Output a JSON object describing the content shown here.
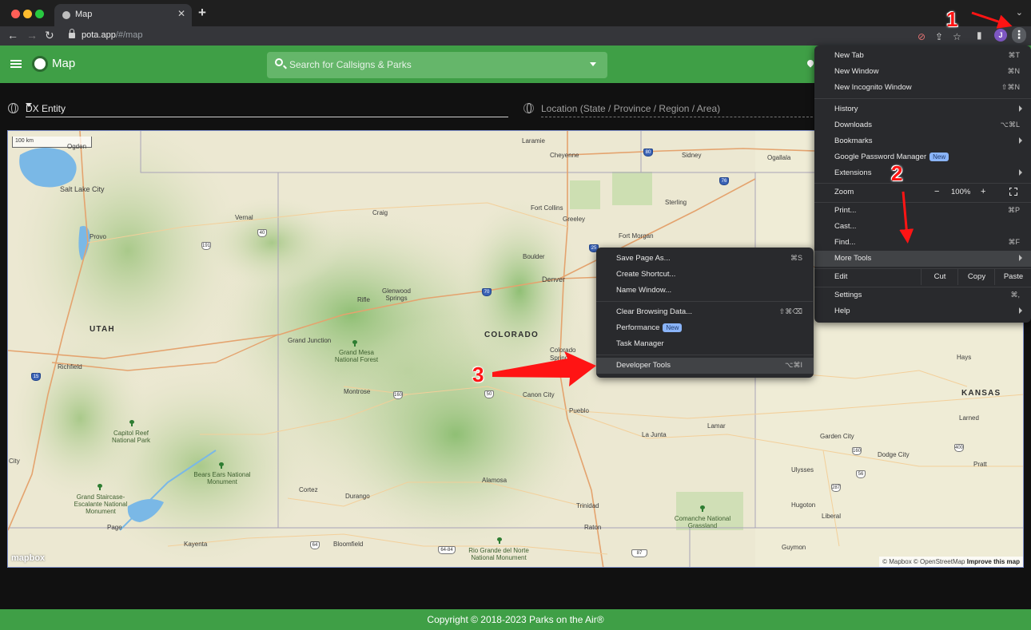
{
  "browser": {
    "tab_title": "Map",
    "tab_close": "✕",
    "new_tab": "+",
    "tab_search": "⌄",
    "url_host": "pota.app",
    "url_path": "/#/map",
    "avatar_initial": "J",
    "menu_kebab": "⋮"
  },
  "app": {
    "title": "Map",
    "search_placeholder": "Search for Callsigns & Parks",
    "dx_entity": "DX Entity",
    "location_placeholder": "Location (State / Province / Region / Area)",
    "footer": "Copyright © 2018-2023 Parks on the Air®"
  },
  "map": {
    "scale": "100 km",
    "mapbox": "mapbox",
    "attribution": "© Mapbox © OpenStreetMap",
    "improve": "Improve this map",
    "states": [
      "UTAH",
      "COLORADO",
      "KANSAS"
    ],
    "cities": [
      "Ogden",
      "Salt Lake City",
      "Provo",
      "Vernal",
      "Craig",
      "Laramie",
      "Cheyenne",
      "Sidney",
      "Ogallala",
      "Fort Collins",
      "Greeley",
      "Sterling",
      "Fort Morgan",
      "Boulder",
      "Denver",
      "Glenwood Springs",
      "Rifle",
      "Grand Junction",
      "Colorado Springs",
      "Canon City",
      "Pueblo",
      "Montrose",
      "Richfield",
      "La Junta",
      "Lamar",
      "Garden City",
      "Dodge City",
      "Hays",
      "Larned",
      "Pratt",
      "Ulysses",
      "Hugoton",
      "Liberal",
      "Guymon",
      "Trinidad",
      "Raton",
      "Alamosa",
      "Durango",
      "Cortez",
      "Bloomfield",
      "Kayenta",
      "Page",
      "City"
    ],
    "parks": [
      "Grand Mesa National Forest",
      "Capitol Reef National Park",
      "Bears Ears National Monument",
      "Grand Staircase-Escalante National Monument",
      "Rio Grande del Norte National Monument",
      "Comanche National Grassland"
    ],
    "highway_shields": [
      "80",
      "76",
      "25",
      "70",
      "40",
      "191",
      "15",
      "50",
      "160",
      "64",
      "64-84",
      "56",
      "87",
      "287",
      "400",
      "160"
    ]
  },
  "chrome_menu": {
    "items": [
      {
        "label": "New Tab",
        "shortcut": "⌘T"
      },
      {
        "label": "New Window",
        "shortcut": "⌘N"
      },
      {
        "label": "New Incognito Window",
        "shortcut": "⇧⌘N"
      },
      {
        "label": "History"
      },
      {
        "label": "Downloads",
        "shortcut": "⌥⌘L"
      },
      {
        "label": "Bookmarks"
      },
      {
        "label": "Google Password Manager",
        "badge": "New"
      },
      {
        "label": "Extensions"
      },
      {
        "label": "Zoom",
        "minus": "−",
        "value": "100%",
        "plus": "+"
      },
      {
        "label": "Print...",
        "shortcut": "⌘P"
      },
      {
        "label": "Cast..."
      },
      {
        "label": "Find...",
        "shortcut": "⌘F"
      },
      {
        "label": "More Tools"
      },
      {
        "label": "Edit",
        "cut": "Cut",
        "copy": "Copy",
        "paste": "Paste"
      },
      {
        "label": "Settings",
        "shortcut": "⌘,"
      },
      {
        "label": "Help"
      }
    ]
  },
  "more_tools_menu": {
    "items": [
      {
        "label": "Save Page As...",
        "shortcut": "⌘S"
      },
      {
        "label": "Create Shortcut..."
      },
      {
        "label": "Name Window..."
      },
      {
        "label": "Clear Browsing Data...",
        "shortcut": "⇧⌘⌫"
      },
      {
        "label": "Performance",
        "badge": "New"
      },
      {
        "label": "Task Manager"
      },
      {
        "label": "Developer Tools",
        "shortcut": "⌥⌘I"
      }
    ]
  },
  "annotations": [
    "1",
    "2",
    "3"
  ],
  "colors": {
    "app_green": "#3f9f46",
    "menu_bg": "#292a2d",
    "annotation_red": "#ff1414"
  }
}
